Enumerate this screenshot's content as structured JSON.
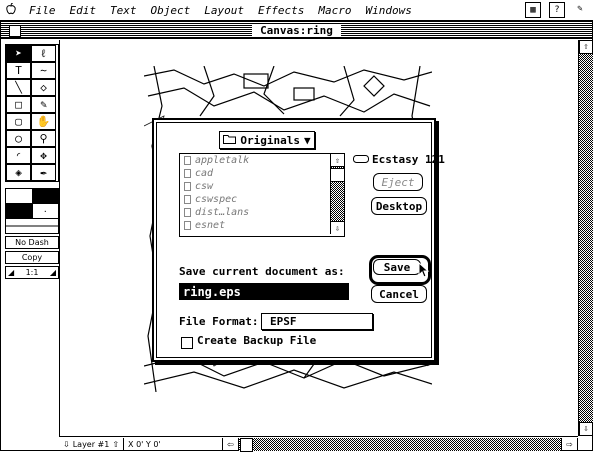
{
  "menubar": {
    "apple": "",
    "items": [
      "File",
      "Edit",
      "Text",
      "Object",
      "Layout",
      "Effects",
      "Macro",
      "Windows"
    ],
    "help_icon": "?"
  },
  "window": {
    "title": "Canvas:ring"
  },
  "toolbox": {
    "line_style_label": "No Dash",
    "copy_label": "Copy",
    "zoom_label": "1:1"
  },
  "statusbar": {
    "layer": "Layer #1",
    "coords": "X 0'  Y 0'"
  },
  "dialog": {
    "folder_popup": "Originals",
    "volume": "Ecstasy 121",
    "files": [
      "appletalk",
      "cad",
      "csw",
      "cswspec",
      "dist…lans",
      "esnet"
    ],
    "eject_label": "Eject",
    "desktop_label": "Desktop",
    "save_prompt": "Save current document as:",
    "filename": "ring.eps",
    "save_label": "Save",
    "cancel_label": "Cancel",
    "format_label": "File Format:",
    "format_value": "EPSF",
    "backup_label": "Create Backup File",
    "backup_checked": false
  }
}
